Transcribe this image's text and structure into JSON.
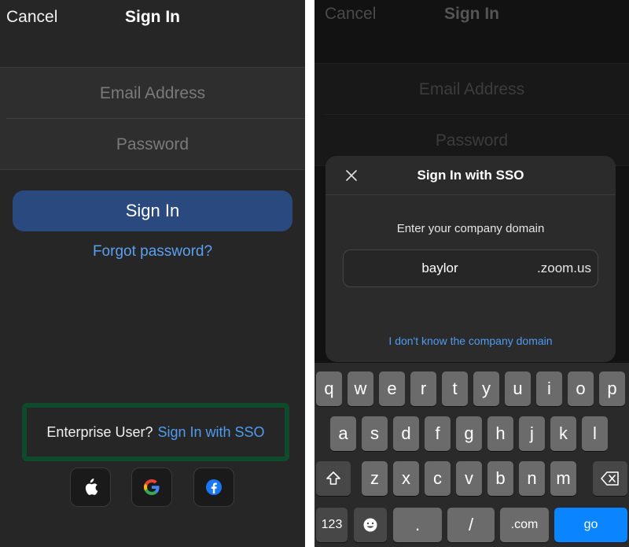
{
  "left": {
    "nav": {
      "cancel": "Cancel",
      "title": "Sign In"
    },
    "fields": {
      "email_placeholder": "Email Address",
      "password_placeholder": "Password"
    },
    "signin_button": "Sign In",
    "forgot_password": "Forgot password?",
    "enterprise": {
      "prompt": "Enterprise User?",
      "link": "Sign In with SSO",
      "highlight_color": "#0e4a2b"
    },
    "social": [
      {
        "icon": "apple-icon"
      },
      {
        "icon": "google-icon"
      },
      {
        "icon": "facebook-icon"
      }
    ]
  },
  "right": {
    "nav": {
      "cancel": "Cancel",
      "title": "Sign In"
    },
    "fields": {
      "email_placeholder": "Email Address",
      "password_placeholder": "Password"
    },
    "modal": {
      "title": "Sign In with SSO",
      "prompt": "Enter your company domain",
      "domain_value": "baylor",
      "domain_suffix": ".zoom.us",
      "unknown_link": "I don't know the company domain"
    },
    "keyboard": {
      "row1": [
        "q",
        "w",
        "e",
        "r",
        "t",
        "y",
        "u",
        "i",
        "o",
        "p"
      ],
      "row2": [
        "a",
        "s",
        "d",
        "f",
        "g",
        "h",
        "j",
        "k",
        "l"
      ],
      "row3": [
        "z",
        "x",
        "c",
        "v",
        "b",
        "n",
        "m"
      ],
      "numbers": "123",
      "dot": ".",
      "slash": "/",
      "dotcom": ".com",
      "go": "go"
    }
  },
  "colors": {
    "accent_blue": "#4f9bf0",
    "signin_button": "#2a4a7f",
    "go_key": "#0a84ff"
  }
}
